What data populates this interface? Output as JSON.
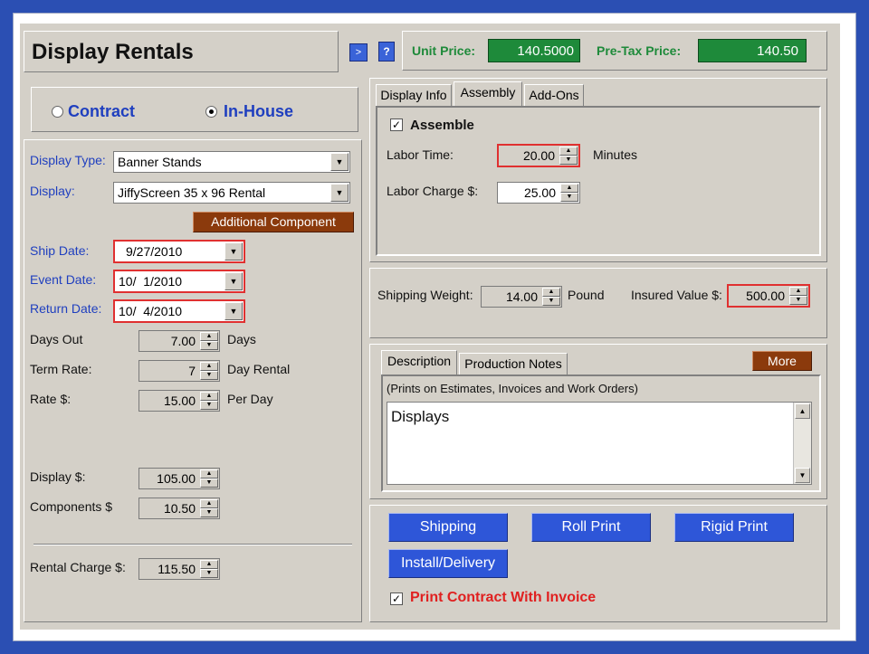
{
  "header": {
    "title": "Display Rentals",
    "unit_price_label": "Unit Price:",
    "unit_price_value": "140.5000",
    "pretax_label": "Pre-Tax Price:",
    "pretax_value": "140.50",
    "nav_icon": ">",
    "help_icon": "?"
  },
  "mode": {
    "contract_label": "Contract",
    "inhouse_label": "In-House",
    "selected": "In-House"
  },
  "left": {
    "display_type_label": "Display Type:",
    "display_type_value": "Banner Stands",
    "display_label": "Display:",
    "display_value": "JiffyScreen 35 x 96 Rental",
    "additional_component": "Additional Component",
    "ship_date_label": "Ship Date:",
    "ship_date_value": "9/27/2010",
    "event_date_label": "Event Date:",
    "event_date_value": "10/  1/2010",
    "return_date_label": "Return Date:",
    "return_date_value": "10/  4/2010",
    "days_out_label": "Days Out",
    "days_out_value": "7.00",
    "days_unit": "Days",
    "term_rate_label": "Term Rate:",
    "term_rate_value": "7",
    "term_rate_unit": "Day Rental",
    "rate_label": "Rate $:",
    "rate_value": "15.00",
    "rate_unit": "Per Day",
    "display_cost_label": "Display $:",
    "display_cost_value": "105.00",
    "components_label": "Components $",
    "components_value": "10.50",
    "rental_charge_label": "Rental Charge $:",
    "rental_charge_value": "115.50"
  },
  "tabs": [
    "Display Info",
    "Assembly",
    "Add-Ons"
  ],
  "assembly": {
    "assemble_label": "Assemble",
    "labor_time_label": "Labor Time:",
    "labor_time_value": "20.00",
    "labor_time_unit": "Minutes",
    "labor_charge_label": "Labor Charge $:",
    "labor_charge_value": "25.00"
  },
  "shipping": {
    "weight_label": "Shipping Weight:",
    "weight_value": "14.00",
    "weight_unit": "Pound",
    "insured_label": "Insured Value $:",
    "insured_value": "500.00"
  },
  "notes": {
    "tab_description": "Description",
    "tab_production": "Production Notes",
    "more_button": "More",
    "hint": "(Prints on Estimates, Invoices and Work Orders)",
    "text": "Displays"
  },
  "actions": {
    "shipping": "Shipping",
    "roll_print": "Roll Print",
    "rigid_print": "Rigid Print",
    "install_delivery": "Install/Delivery",
    "print_contract": "Print Contract With Invoice"
  },
  "colors": {
    "accent_blue": "#2e56d8",
    "price_green": "#1e8a3a",
    "label_blue": "#1f3fbf",
    "brown": "#8b3a0c",
    "alert_red": "#e03030"
  }
}
